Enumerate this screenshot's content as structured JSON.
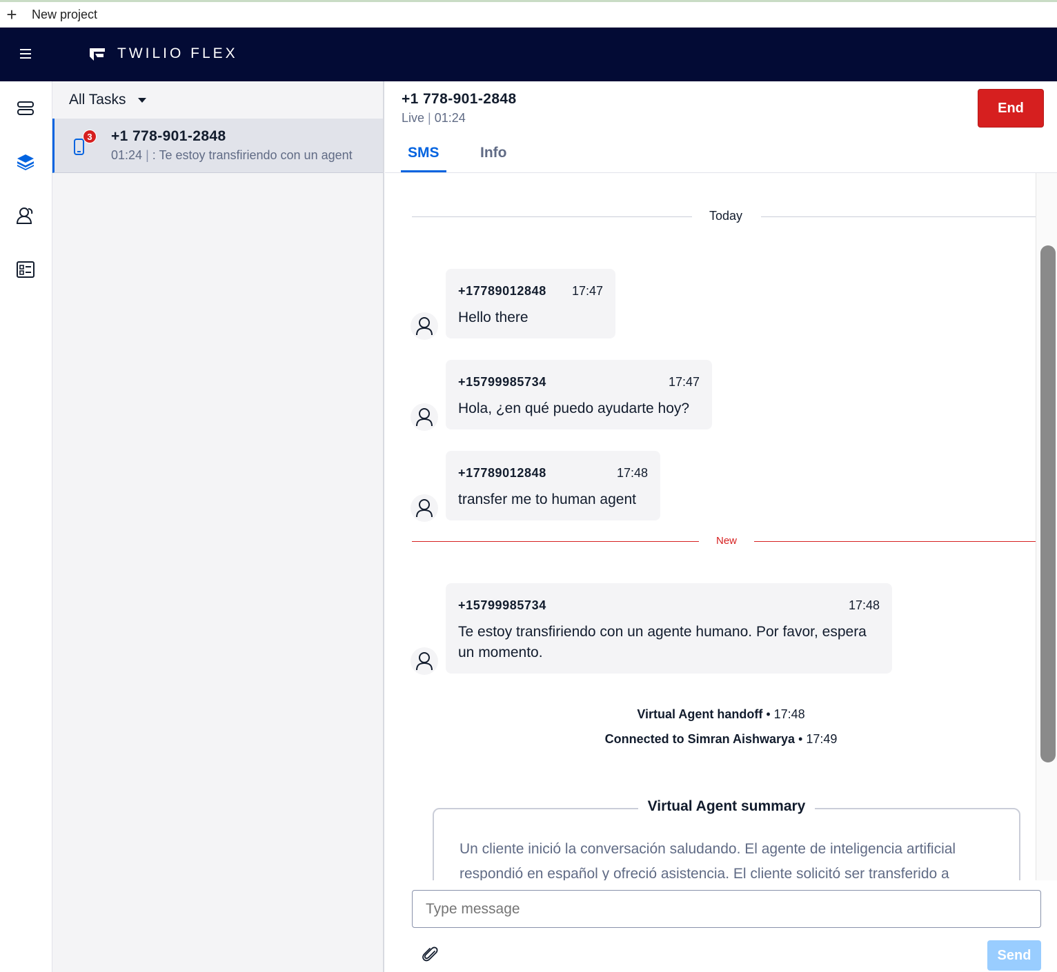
{
  "topbar": {
    "new_project_label": "New project"
  },
  "header": {
    "brand": "TWILIO FLEX"
  },
  "rail": {
    "icons": [
      "agent-desktop-icon",
      "tasks-layers-icon",
      "teams-icon",
      "queue-stats-icon"
    ]
  },
  "tasklist": {
    "filter_label": "All Tasks",
    "tasks": [
      {
        "name": "+1 778-901-2848",
        "badge": "3",
        "time": "01:24",
        "preview": ": Te estoy transfiriendo con un agent"
      }
    ]
  },
  "conversation": {
    "name": "+1 778-901-2848",
    "status": "Live",
    "timer": "01:24",
    "end_label": "End",
    "tabs": [
      {
        "label": "SMS"
      },
      {
        "label": "Info"
      }
    ],
    "today_label": "Today",
    "new_label": "New",
    "messages": [
      {
        "from": "+17789012848",
        "time": "17:47",
        "text": "Hello there"
      },
      {
        "from": "+15799985734",
        "time": "17:47",
        "text": "Hola, ¿en qué puedo ayudarte hoy?"
      },
      {
        "from": "+17789012848",
        "time": "17:48",
        "text": "transfer me to human agent"
      },
      {
        "from": "+15799985734",
        "time": "17:48",
        "text": "Te estoy transfiriendo con un agente humano. Por favor, espera un momento."
      }
    ],
    "events": [
      {
        "label": "Virtual Agent handoff",
        "time": "17:48"
      },
      {
        "label": "Connected to Simran Aishwarya",
        "time": "17:49"
      }
    ],
    "summary": {
      "title": "Virtual Agent summary",
      "text": "Un cliente inició la conversación saludando. El agente de inteligencia artificial respondió en español y ofreció asistencia. El cliente solicitó ser transferido a"
    },
    "composer": {
      "placeholder": "Type message",
      "send_label": "Send"
    }
  },
  "colors": {
    "header_bg": "#030b35",
    "accent": "#0263e0",
    "end_red": "#d61f1f",
    "send_disabled": "#99cdff",
    "new_divider": "#d61f1f"
  }
}
